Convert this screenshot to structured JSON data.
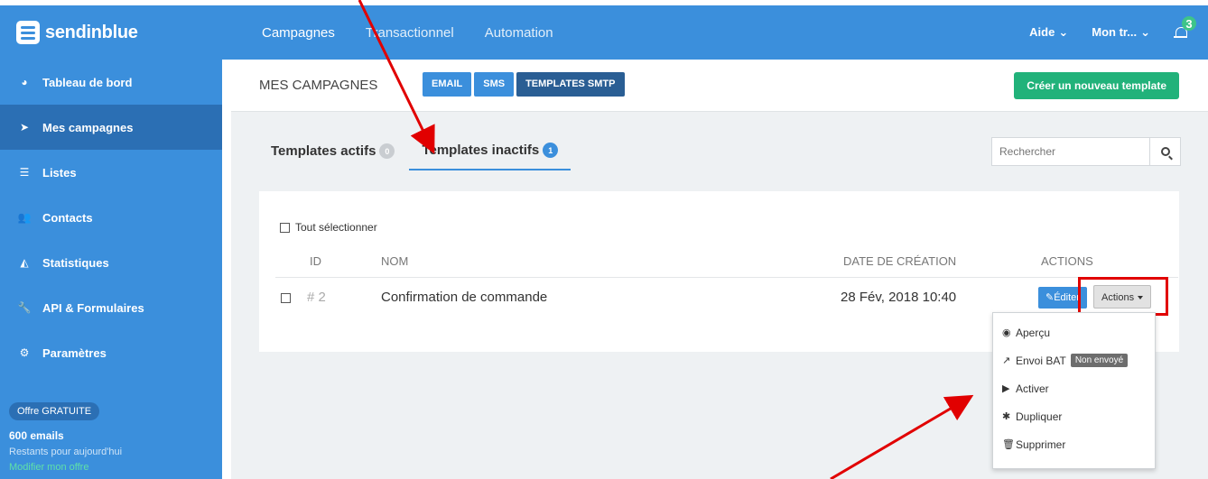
{
  "topbar": {
    "logo_text": "sendinblue",
    "nav": [
      "Campagnes",
      "Transactionnel",
      "Automation"
    ],
    "aide_label": "Aide",
    "account_label": "Mon tr...",
    "notification_count": "3"
  },
  "sidebar": {
    "items": [
      {
        "label": "Tableau de bord",
        "icon": "dashboard-icon"
      },
      {
        "label": "Mes campagnes",
        "icon": "paper-plane-icon"
      },
      {
        "label": "Listes",
        "icon": "list-icon"
      },
      {
        "label": "Contacts",
        "icon": "users-icon"
      },
      {
        "label": "Statistiques",
        "icon": "area-chart-icon"
      },
      {
        "label": "API & Formulaires",
        "icon": "wrench-icon"
      },
      {
        "label": "Paramètres",
        "icon": "gear-icon"
      }
    ],
    "offer_badge": "Offre GRATUITE",
    "offer_emails": "600 emails",
    "offer_sub": "Restants pour aujourd'hui",
    "offer_link": "Modifier mon offre"
  },
  "header": {
    "title": "MES CAMPAGNES",
    "segments": [
      "EMAIL",
      "SMS",
      "TEMPLATES SMTP"
    ],
    "create_button": "Créer un nouveau template"
  },
  "tabs": [
    {
      "label": "Templates actifs",
      "count": "0"
    },
    {
      "label": "Templates inactifs",
      "count": "1"
    }
  ],
  "search": {
    "placeholder": "Rechercher"
  },
  "table": {
    "select_all": "Tout sélectionner",
    "columns": [
      "ID",
      "NOM",
      "DATE DE CRÉATION",
      "ACTIONS"
    ],
    "rows": [
      {
        "id": "# 2",
        "name": "Confirmation de commande",
        "date": "28 Fév, 2018 10:40"
      }
    ],
    "edit_label": "Éditer",
    "actions_label": "Actions"
  },
  "menu": {
    "items": [
      "Aperçu",
      "Envoi BAT",
      "Activer",
      "Dupliquer",
      "Supprimer"
    ],
    "bat_status": "Non envoyé"
  },
  "colors": {
    "primary": "#3b8fdc",
    "green": "#21b27a",
    "annotation": "#e10000"
  }
}
